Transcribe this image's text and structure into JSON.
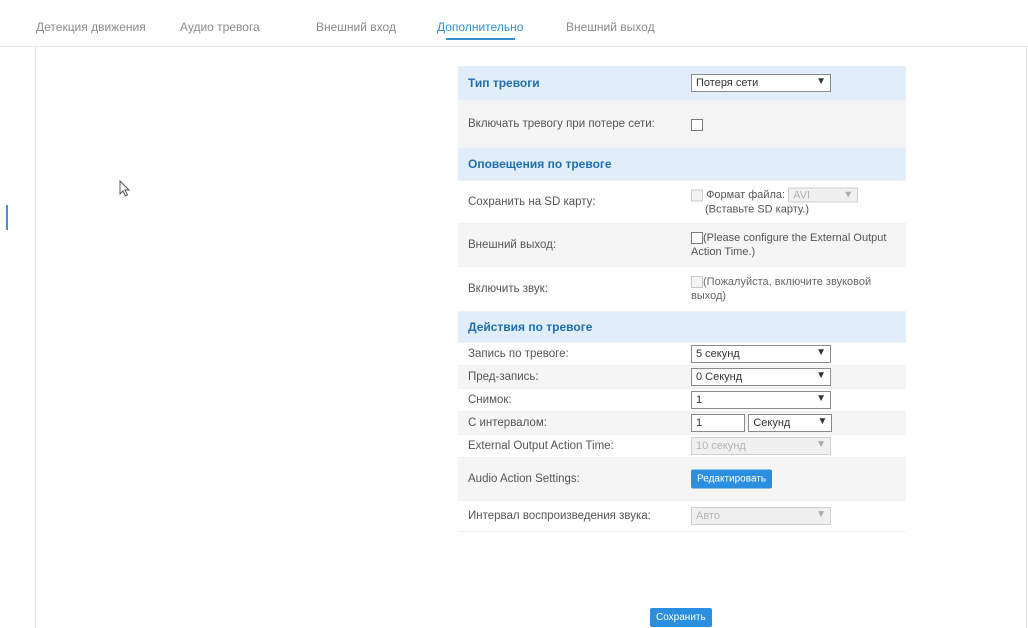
{
  "tabs": [
    {
      "label": "Детекция движения"
    },
    {
      "label": "Аудио тревога"
    },
    {
      "label": "Внешний вход"
    },
    {
      "label": "Дополнительно"
    },
    {
      "label": "Внешний выход"
    }
  ],
  "active_tab_index": 3,
  "form": {
    "alarm_type": {
      "label": "Тип тревоги",
      "value": "Потеря сети"
    },
    "enable_on_network_loss": {
      "label": "Включать тревогу при потере сети:",
      "checked": false
    },
    "notifications": {
      "header": "Оповещения по тревоге",
      "save_to_sd": {
        "label": "Сохранить на SD карту:",
        "format_label": "Формат файла:",
        "format_value": "AVI",
        "note": "(Вставьте SD карту.)"
      },
      "external_output": {
        "label": "Внешний выход:",
        "note": "(Please configure the External Output Action Time.)"
      },
      "enable_sound": {
        "label": "Включить звук:",
        "note": "(Пожалуйста, включите звуковой выход)"
      }
    },
    "actions": {
      "header": "Действия по тревоге",
      "alarm_record": {
        "label": "Запись по тревоге:",
        "value": "5 секунд"
      },
      "pre_record": {
        "label": "Пред-запись:",
        "value": "0 Секунд"
      },
      "snapshots": {
        "label": "Снимок:",
        "value": "1"
      },
      "interval": {
        "label": "С интервалом:",
        "value": "1",
        "unit": "Секунд"
      },
      "external_output_time": {
        "label": "External Output Action Time:",
        "value": "10 секунд"
      },
      "audio_action_settings": {
        "label": "Audio Action Settings:",
        "button": "Редактировать"
      },
      "sound_interval": {
        "label": "Интервал воспроизведения звука:",
        "value": "Авто"
      }
    },
    "save_button": "Сохранить"
  },
  "colors": {
    "accent": "#2f8fd0",
    "header_bg": "#e1edf8",
    "button": "#2a8fe0"
  }
}
